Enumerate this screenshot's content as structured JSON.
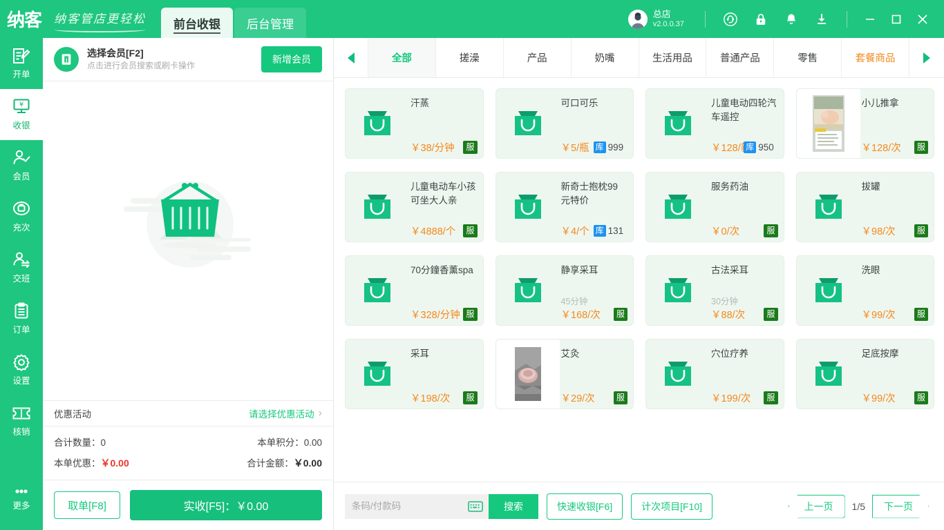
{
  "brand": {
    "logo": "纳客",
    "slogan": "纳客管店更轻松"
  },
  "titlebar": {
    "tabs": [
      {
        "label": "前台收银",
        "active": true
      },
      {
        "label": "后台管理",
        "active": false
      }
    ],
    "user": {
      "name": "总店",
      "version": "v2.0.0.37"
    },
    "icons": [
      "headset-icon",
      "lock-icon",
      "bell-icon",
      "download-icon"
    ],
    "window": {
      "minimize": "–",
      "maximize": "▢",
      "close": "✕"
    }
  },
  "sidebar": {
    "items": [
      {
        "label": "开单",
        "icon": "order-create-icon",
        "active": false
      },
      {
        "label": "收银",
        "icon": "cashier-icon",
        "active": true
      },
      {
        "label": "会员",
        "icon": "member-icon",
        "active": false
      },
      {
        "label": "充次",
        "icon": "recharge-icon",
        "active": false
      },
      {
        "label": "交班",
        "icon": "shift-icon",
        "active": false
      },
      {
        "label": "订单",
        "icon": "clipboard-icon",
        "active": false
      },
      {
        "label": "设置",
        "icon": "gear-icon",
        "active": false
      },
      {
        "label": "核销",
        "icon": "ticket-icon",
        "active": false
      },
      {
        "label": "更多",
        "icon": "more-dots-icon",
        "active": false
      }
    ]
  },
  "order_panel": {
    "member": {
      "title": "选择会员[F2]",
      "subtitle": "点击进行会员搜索或刷卡操作",
      "add_button": "新增会员"
    },
    "promo": {
      "label": "优惠活动",
      "value": "请选择优惠活动"
    },
    "totals": {
      "qty_label": "合计数量：",
      "qty_value": "0",
      "points_label": "本单积分：",
      "points_value": "0.00",
      "discount_label": "本单优惠：",
      "discount_value": "￥0.00",
      "amount_label": "合计金额：",
      "amount_value": "￥0.00"
    },
    "actions": {
      "hold": "取单[F8]",
      "pay": "实收[F5]：￥0.00"
    }
  },
  "categories": [
    {
      "label": "全部",
      "active": true,
      "highlight": false
    },
    {
      "label": "搓澡",
      "active": false,
      "highlight": false
    },
    {
      "label": "产品",
      "active": false,
      "highlight": false
    },
    {
      "label": "奶嘴",
      "active": false,
      "highlight": false
    },
    {
      "label": "生活用品",
      "active": false,
      "highlight": false
    },
    {
      "label": "普通产品",
      "active": false,
      "highlight": false
    },
    {
      "label": "零售",
      "active": false,
      "highlight": false
    },
    {
      "label": "套餐商品",
      "active": false,
      "highlight": true
    }
  ],
  "products": [
    {
      "name": "汗蒸",
      "price": "￥38/分钟",
      "duration": "",
      "badge": "服",
      "stock": "",
      "thumb": "bag-icon"
    },
    {
      "name": "可口可乐",
      "price": "￥5/瓶",
      "duration": "",
      "badge": "",
      "stock": "999",
      "stock_badge": "库",
      "thumb": "bag-icon"
    },
    {
      "name": "儿童电动四轮汽车遥控",
      "price": "￥128/新",
      "duration": "",
      "badge": "",
      "stock": "950",
      "stock_badge": "库",
      "thumb": "bag-icon",
      "overlap": true
    },
    {
      "name": "小儿推拿",
      "price": "￥128/次",
      "duration": "",
      "badge": "服",
      "stock": "",
      "thumb": "photo-baby-massage"
    },
    {
      "name": "儿童电动车小孩可坐大人亲",
      "price": "￥4888/个",
      "duration": "",
      "badge": "服",
      "stock": "",
      "thumb": "bag-icon"
    },
    {
      "name": "新奇士抱枕99元特价",
      "price": "￥4/个",
      "duration": "",
      "badge": "",
      "stock": "131",
      "stock_badge": "库",
      "thumb": "bag-icon"
    },
    {
      "name": "服务药油",
      "price": "￥0/次",
      "duration": "",
      "badge": "服",
      "stock": "",
      "thumb": "bag-icon"
    },
    {
      "name": "拔罐",
      "price": "￥98/次",
      "duration": "",
      "badge": "服",
      "stock": "",
      "thumb": "bag-icon"
    },
    {
      "name": "70分鐘香薰spa",
      "price": "￥328/分钟",
      "duration": "",
      "badge": "服",
      "stock": "",
      "thumb": "bag-icon"
    },
    {
      "name": "静享采耳",
      "price": "￥168/次",
      "duration": "45分钟",
      "badge": "服",
      "stock": "",
      "thumb": "bag-icon"
    },
    {
      "name": "古法采耳",
      "price": "￥88/次",
      "duration": "30分钟",
      "badge": "服",
      "stock": "",
      "thumb": "bag-icon"
    },
    {
      "name": "洗眼",
      "price": "￥99/次",
      "duration": "",
      "badge": "服",
      "stock": "",
      "thumb": "bag-icon"
    },
    {
      "name": "采耳",
      "price": "￥198/次",
      "duration": "",
      "badge": "服",
      "stock": "",
      "thumb": "bag-icon"
    },
    {
      "name": "艾灸",
      "price": "￥29/次",
      "duration": "",
      "badge": "服",
      "stock": "",
      "thumb": "photo-moxibustion"
    },
    {
      "name": "穴位疗养",
      "price": "￥199/次",
      "duration": "",
      "badge": "服",
      "stock": "",
      "thumb": "bag-icon"
    },
    {
      "name": "足底按摩",
      "price": "￥99/次",
      "duration": "",
      "badge": "服",
      "stock": "",
      "thumb": "bag-icon"
    }
  ],
  "bottombar": {
    "search_placeholder": "条码/付款码",
    "search_value": "",
    "search_button": "搜索",
    "quick_cashier": "快速收银[F6]",
    "count_item": "计次项目[F10]",
    "prev_page": "上一页",
    "page_indicator": "1/5",
    "next_page": "下一页"
  },
  "colors": {
    "brand_green": "#1ec67f",
    "price_orange": "#f5881f",
    "badge_service_green": "#1b7a1b",
    "badge_stock_blue": "#1e92f0",
    "discount_red": "#e8362c",
    "highlight_orange": "#f08c22"
  }
}
